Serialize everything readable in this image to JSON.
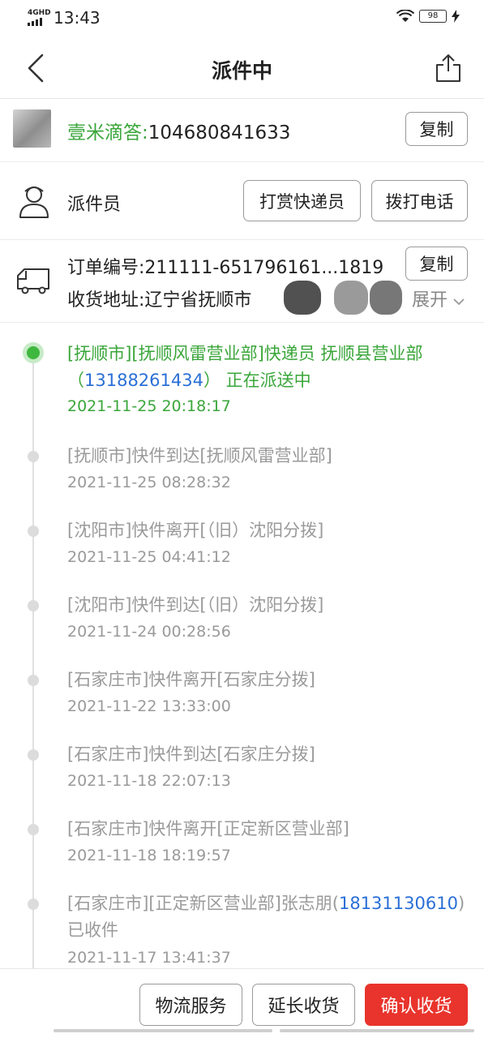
{
  "status_bar": {
    "network": "4GHD",
    "time": "13:43",
    "battery": "98"
  },
  "nav": {
    "title": "派件中"
  },
  "tracking": {
    "carrier": "壹米滴答:",
    "number": "104680841633",
    "copy_label": "复制"
  },
  "courier": {
    "label": "派件员",
    "reward_label": "打赏快递员",
    "call_label": "拨打电话"
  },
  "order": {
    "number_prefix": "订单编号:",
    "number": "211111-651796161...1819",
    "copy_label": "复制",
    "address_prefix": "收货地址:",
    "address": "辽宁省抚顺市",
    "expand_label": "展开"
  },
  "timeline": [
    {
      "text_prefix": "[抚顺市][抚顺风雷营业部]快递员  抚顺县营业部（",
      "phone": "13188261434",
      "text_suffix": "）   正在派送中",
      "time": "2021-11-25 20:18:17"
    },
    {
      "text": "[抚顺市]快件到达[抚顺风雷营业部]",
      "time": "2021-11-25 08:28:32"
    },
    {
      "text": "[沈阳市]快件离开[（旧）沈阳分拨]",
      "time": "2021-11-25 04:41:12"
    },
    {
      "text": "[沈阳市]快件到达[（旧）沈阳分拨]",
      "time": "2021-11-24 00:28:56"
    },
    {
      "text": "[石家庄市]快件离开[石家庄分拨]",
      "time": "2021-11-22 13:33:00"
    },
    {
      "text": "[石家庄市]快件到达[石家庄分拨]",
      "time": "2021-11-18 22:07:13"
    },
    {
      "text": "[石家庄市]快件离开[正定新区营业部]",
      "time": "2021-11-18 18:19:57"
    },
    {
      "text_prefix": "[石家庄市][正定新区营业部]张志朋(",
      "phone": "18131130610",
      "text_suffix": ")  已收件",
      "time": "2021-11-17 13:41:37"
    }
  ],
  "bottom": {
    "logistics_label": "物流服务",
    "extend_label": "延长收货",
    "confirm_label": "确认收货"
  },
  "colors": {
    "accent_green": "#3aa63a",
    "link_blue": "#2a6fd6",
    "confirm_red": "#e8342c"
  }
}
